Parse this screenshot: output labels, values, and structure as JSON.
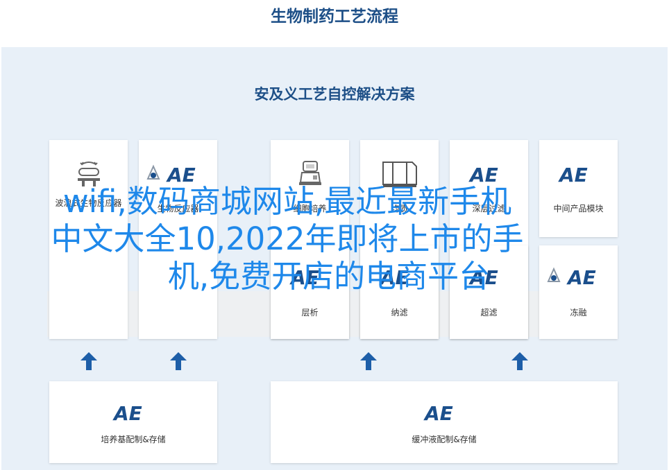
{
  "header": {
    "title": "生物制药工艺流程"
  },
  "panel": {
    "title": "安及义工艺自控解决方案"
  },
  "cards": {
    "row1": [
      {
        "label": "波浪式生物反应器",
        "icon": "wave-bioreactor-icon"
      },
      {
        "label": "生物反应器",
        "icon": "ae-logo-icon"
      },
      {
        "label": "细胞培养",
        "icon": "lab-instrument-icon"
      },
      {
        "label": "均质",
        "icon": "homogenizer-icon"
      },
      {
        "label": "深层过滤",
        "icon": "ae-logo-icon"
      },
      {
        "label": "中间产品模块",
        "icon": "ae-logo-icon"
      }
    ],
    "row2": [
      {
        "label": "层析",
        "icon": "ae-logo-icon"
      },
      {
        "label": "纳滤",
        "icon": "ae-logo-icon"
      },
      {
        "label": "超滤",
        "icon": "ae-logo-icon"
      },
      {
        "label": "冻融",
        "icon": "ae-logo-icon"
      }
    ],
    "row3": [
      {
        "label": "培养基配制&存储",
        "icon": "ae-logo-icon"
      },
      {
        "label": "缓冲液配制&存储",
        "icon": "ae-logo-icon"
      }
    ]
  },
  "overlay": {
    "line1": "wifi,数码商城网站,最近最新手机",
    "line2": "中文大全10,2022年即将上市的手",
    "line3": "机,免费开店的电商平台"
  },
  "colors": {
    "title": "#1d4f87",
    "panel_bg": "#e8f0f8",
    "logo_blue": "#1b4f8c",
    "arrow_blue": "#1d5ea8",
    "overlay_text": "#1e88ea"
  }
}
